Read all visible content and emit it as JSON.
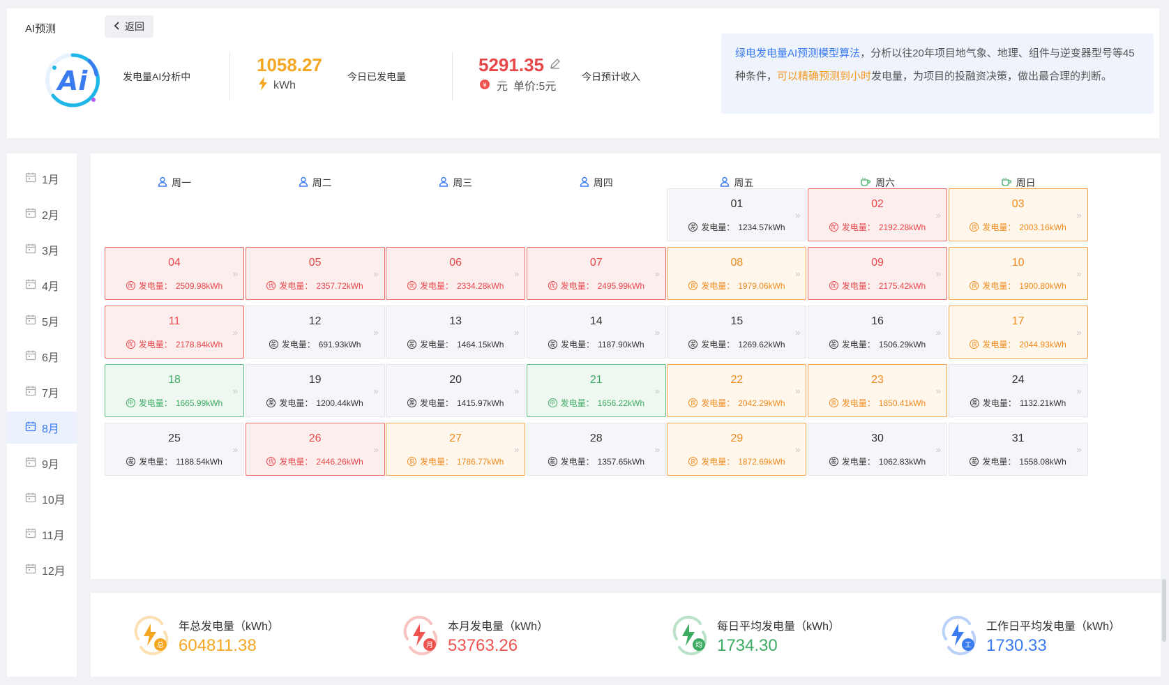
{
  "header": {
    "title": "AI预测",
    "back_label": "返回",
    "ai_status": "发电量AI分析中",
    "today_gen_value": "1058.27",
    "today_gen_unit": "kWh",
    "today_gen_label": "今日已发电量",
    "today_income_value": "5291.35",
    "today_income_unit": "元",
    "today_income_price": "单价:5元",
    "today_income_label": "今日预计收入",
    "info_part1": "绿电发电量AI预测模型算法",
    "info_part2": "，分析以往20年项目地气象、地理、组件与逆变器型号等45种条件，",
    "info_part3": "可以精确预测到小时",
    "info_part4": "发电量，为项目的投融资决策，做出最合理的判断。"
  },
  "months": [
    "1月",
    "2月",
    "3月",
    "4月",
    "5月",
    "6月",
    "7月",
    "8月",
    "9月",
    "10月",
    "11月",
    "12月"
  ],
  "active_month_index": 7,
  "weekdays": [
    "周一",
    "周二",
    "周三",
    "周四",
    "周五",
    "周六",
    "周日"
  ],
  "gen_prefix": "发电量：",
  "badges": {
    "red": "优",
    "orange": "良",
    "green": "中",
    "gray": "差"
  },
  "calendar_days": [
    {
      "day": "01",
      "gen": "1234.57kWh",
      "level": "gray"
    },
    {
      "day": "02",
      "gen": "2192.28kWh",
      "level": "red"
    },
    {
      "day": "03",
      "gen": "2003.16kWh",
      "level": "orange"
    },
    {
      "day": "04",
      "gen": "2509.98kWh",
      "level": "red"
    },
    {
      "day": "05",
      "gen": "2357.72kWh",
      "level": "red"
    },
    {
      "day": "06",
      "gen": "2334.28kWh",
      "level": "red"
    },
    {
      "day": "07",
      "gen": "2495.99kWh",
      "level": "red"
    },
    {
      "day": "08",
      "gen": "1979.06kWh",
      "level": "orange"
    },
    {
      "day": "09",
      "gen": "2175.42kWh",
      "level": "red"
    },
    {
      "day": "10",
      "gen": "1900.80kWh",
      "level": "orange"
    },
    {
      "day": "11",
      "gen": "2178.84kWh",
      "level": "red"
    },
    {
      "day": "12",
      "gen": "691.93kWh",
      "level": "gray"
    },
    {
      "day": "13",
      "gen": "1464.15kWh",
      "level": "gray"
    },
    {
      "day": "14",
      "gen": "1187.90kWh",
      "level": "gray"
    },
    {
      "day": "15",
      "gen": "1269.62kWh",
      "level": "gray"
    },
    {
      "day": "16",
      "gen": "1506.29kWh",
      "level": "gray"
    },
    {
      "day": "17",
      "gen": "2044.93kWh",
      "level": "orange"
    },
    {
      "day": "18",
      "gen": "1665.99kWh",
      "level": "green"
    },
    {
      "day": "19",
      "gen": "1200.44kWh",
      "level": "gray"
    },
    {
      "day": "20",
      "gen": "1415.97kWh",
      "level": "gray"
    },
    {
      "day": "21",
      "gen": "1656.22kWh",
      "level": "green"
    },
    {
      "day": "22",
      "gen": "2042.29kWh",
      "level": "orange"
    },
    {
      "day": "23",
      "gen": "1850.41kWh",
      "level": "orange"
    },
    {
      "day": "24",
      "gen": "1132.21kWh",
      "level": "gray"
    },
    {
      "day": "25",
      "gen": "1188.54kWh",
      "level": "gray"
    },
    {
      "day": "26",
      "gen": "2446.26kWh",
      "level": "red"
    },
    {
      "day": "27",
      "gen": "1786.77kWh",
      "level": "orange"
    },
    {
      "day": "28",
      "gen": "1357.65kWh",
      "level": "gray"
    },
    {
      "day": "29",
      "gen": "1872.69kWh",
      "level": "orange"
    },
    {
      "day": "30",
      "gen": "1062.83kWh",
      "level": "gray"
    },
    {
      "day": "31",
      "gen": "1558.08kWh",
      "level": "gray"
    }
  ],
  "stats": [
    {
      "label": "年总发电量（kWh）",
      "value": "604811.38",
      "color": "#f5a623",
      "badge": "总"
    },
    {
      "label": "本月发电量（kWh）",
      "value": "53763.26",
      "color": "#ef5350",
      "badge": "月"
    },
    {
      "label": "每日平均发电量（kWh）",
      "value": "1734.30",
      "color": "#3dab63",
      "badge": "均"
    },
    {
      "label": "工作日平均发电量（kWh）",
      "value": "1730.33",
      "color": "#3a7bf0",
      "badge": "工"
    }
  ]
}
